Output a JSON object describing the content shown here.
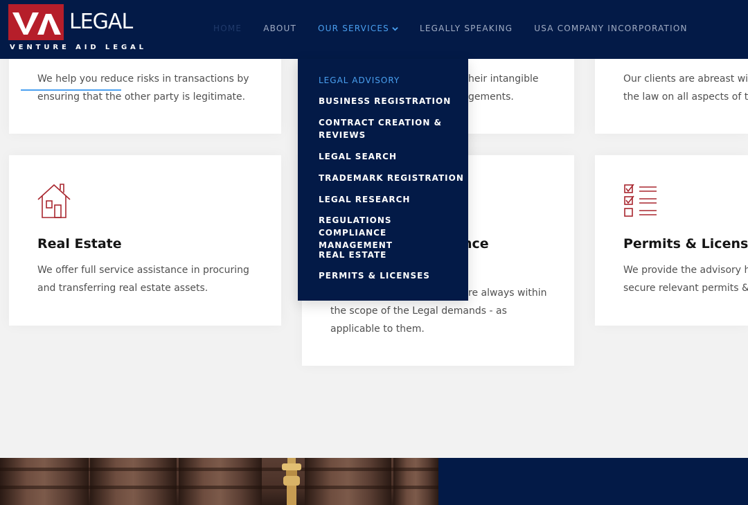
{
  "brand": {
    "mark": "VA",
    "word": "LEGAL",
    "tagline": "VENTURE AID LEGAL"
  },
  "nav": {
    "home": "HOME",
    "about": "ABOUT",
    "services": "OUR SERVICES",
    "speaking": "LEGALLY SPEAKING",
    "usa": "USA COMPANY INCORPORATION"
  },
  "dropdown": {
    "items": [
      "LEGAL ADVISORY",
      "BUSINESS REGISTRATION",
      "CONTRACT CREATION & REVIEWS",
      "LEGAL SEARCH",
      "TRADEMARK REGISTRATION",
      "LEGAL RESEARCH",
      "REGULATIONS COMPLIANCE MANAGEMENT",
      "REAL ESTATE",
      "PERMITS & LICENSES"
    ]
  },
  "cards": {
    "top_left": {
      "text": "We help you reduce risks in transactions by ensuring that the other party is legitimate."
    },
    "top_mid": {
      "text_line1": "heir intangible",
      "text_line2": "gements."
    },
    "top_right": {
      "text_line1": "Our clients are abreast wit",
      "text_line2": "the law on all aspects of t"
    },
    "real_estate": {
      "title": "Real Estate",
      "text": "We offer full service assistance in procuring and transferring real estate assets."
    },
    "compliance": {
      "title_fragment": "nce",
      "text_line1": "re always within",
      "text_line2": "the scope of the Legal demands - as",
      "text_line3": "applicable to them."
    },
    "permits": {
      "title": "Permits & Licenses",
      "text_line1": "We provide the advisory h",
      "text_line2": "secure relevant permits &"
    }
  },
  "colors": {
    "navy": "#031a47",
    "accent_blue": "#4aa0f0",
    "brand_red": "#b61e2a",
    "icon_red": "#a8262e"
  },
  "icons": {
    "house": "house-icon",
    "checklist": "checklist-icon",
    "chevron": "chevron-down-icon"
  }
}
